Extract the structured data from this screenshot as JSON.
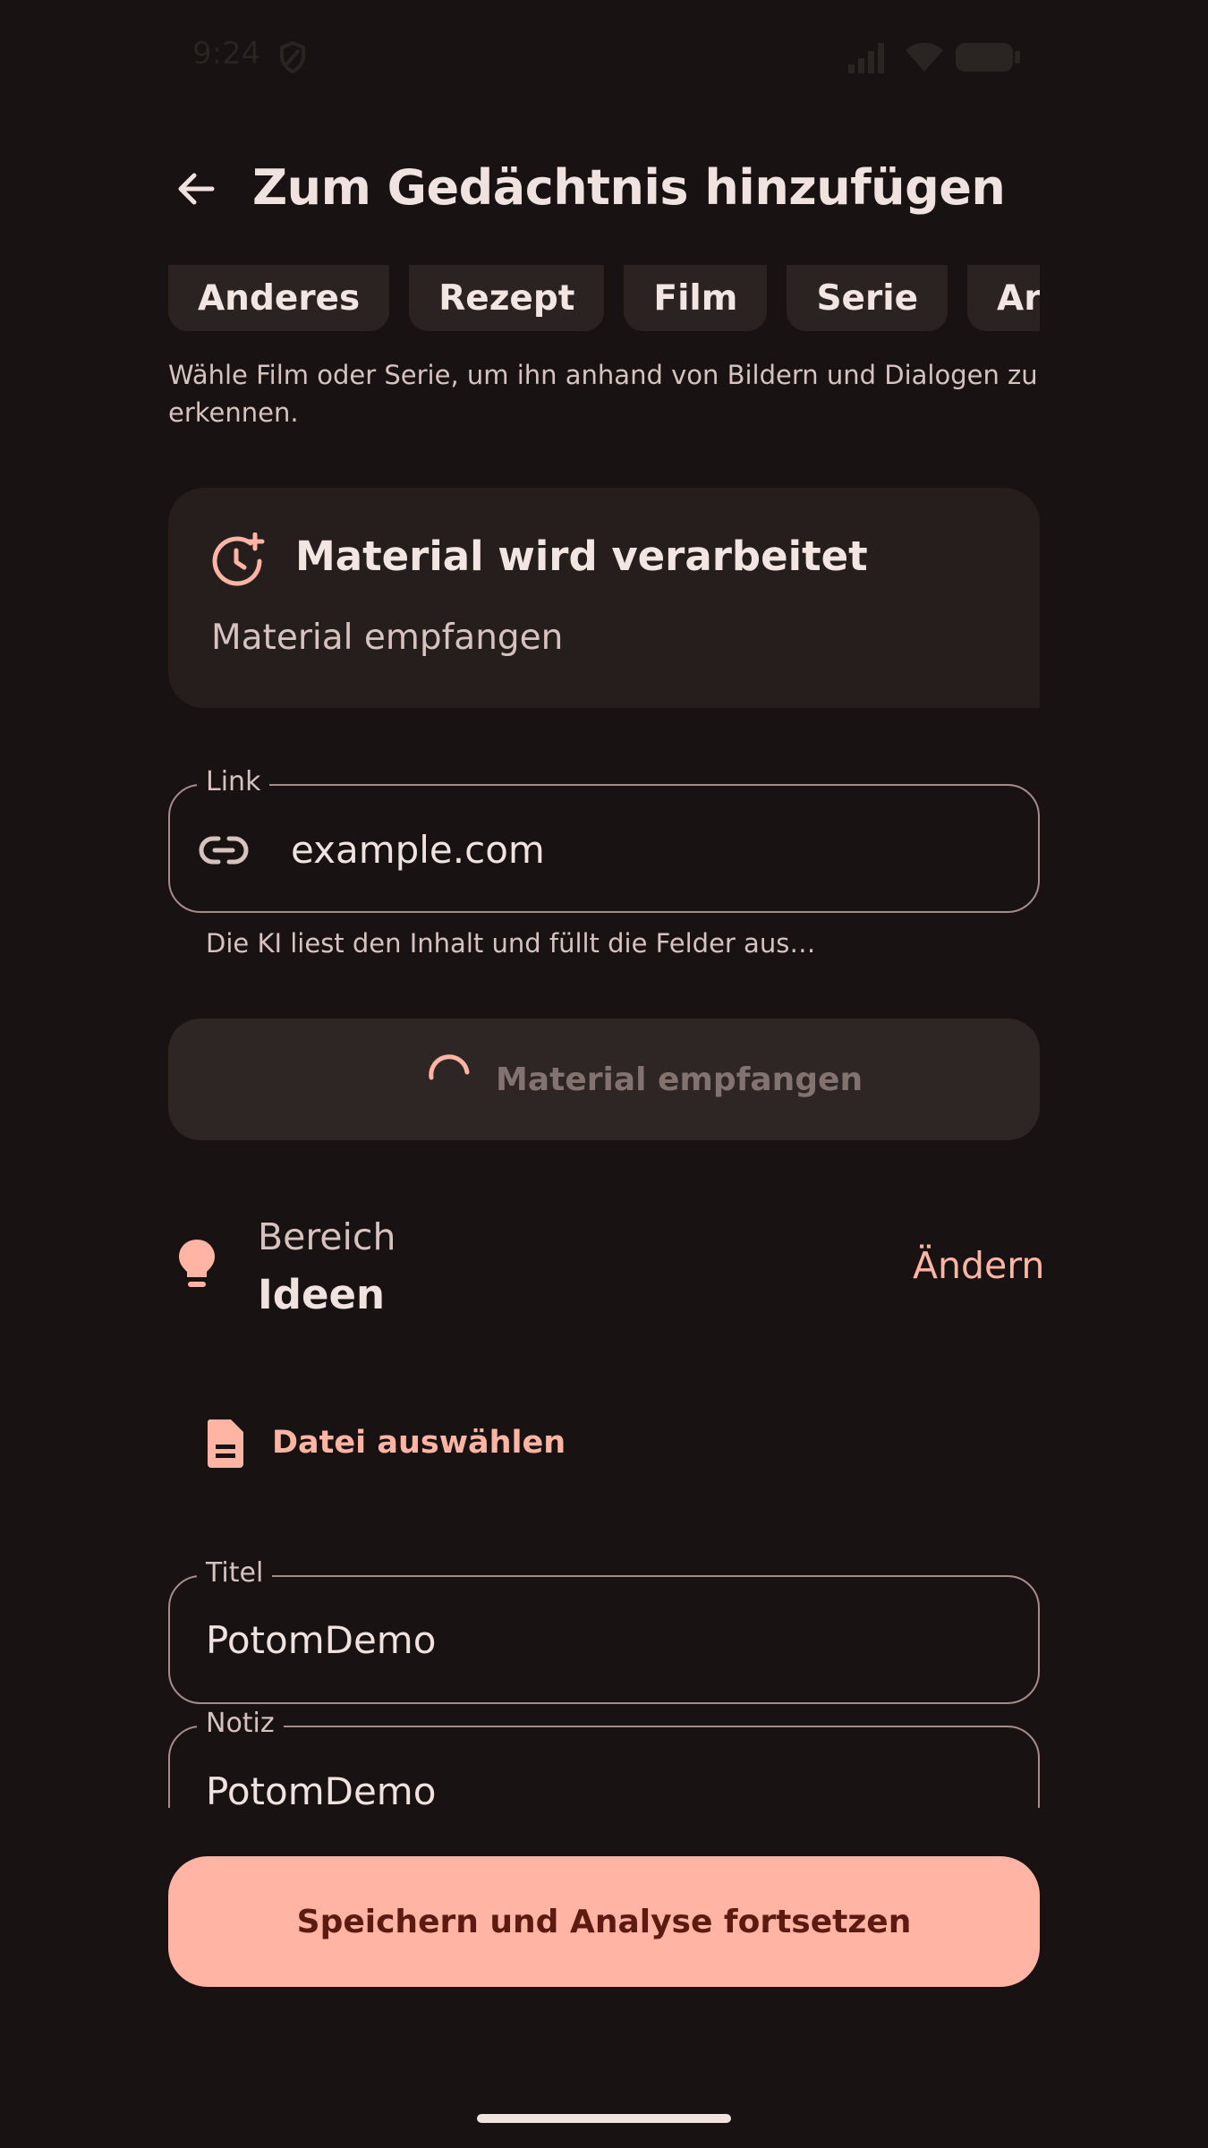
{
  "status_bar": {
    "time": "9:24"
  },
  "app_bar": {
    "title": "Zum Gedächtnis hinzufügen"
  },
  "chips": [
    "Anderes",
    "Rezept",
    "Film",
    "Serie",
    "Artikel"
  ],
  "hint": "Wähle Film oder Serie, um ihn anhand von Bildern und Dialogen zu erkennen.",
  "processing_card": {
    "title": "Material wird verarbeitet",
    "status": "Material empfangen"
  },
  "link_field": {
    "label": "Link",
    "value": "example.com",
    "supporting_text": "Die KI liest den Inhalt und füllt die Felder aus…"
  },
  "busy_button": {
    "label": "Material empfangen"
  },
  "area": {
    "label": "Bereich",
    "value": "Ideen",
    "change_label": "Ändern"
  },
  "file_picker": {
    "label": "Datei auswählen"
  },
  "title_field": {
    "label": "Titel",
    "value": "PotomDemo"
  },
  "note_field": {
    "label": "Notiz",
    "value": "PotomDemo"
  },
  "save_button": {
    "label": "Speichern und Analyse fortsetzen"
  },
  "colors": {
    "accent": "#ffb4a4",
    "background": "#181312",
    "surface": "#251e1d"
  },
  "icons": [
    "back-arrow-icon",
    "clock-plus-icon",
    "link-icon",
    "spinner-icon",
    "lightbulb-icon",
    "document-icon",
    "signal-icon",
    "wifi-icon",
    "battery-icon"
  ]
}
